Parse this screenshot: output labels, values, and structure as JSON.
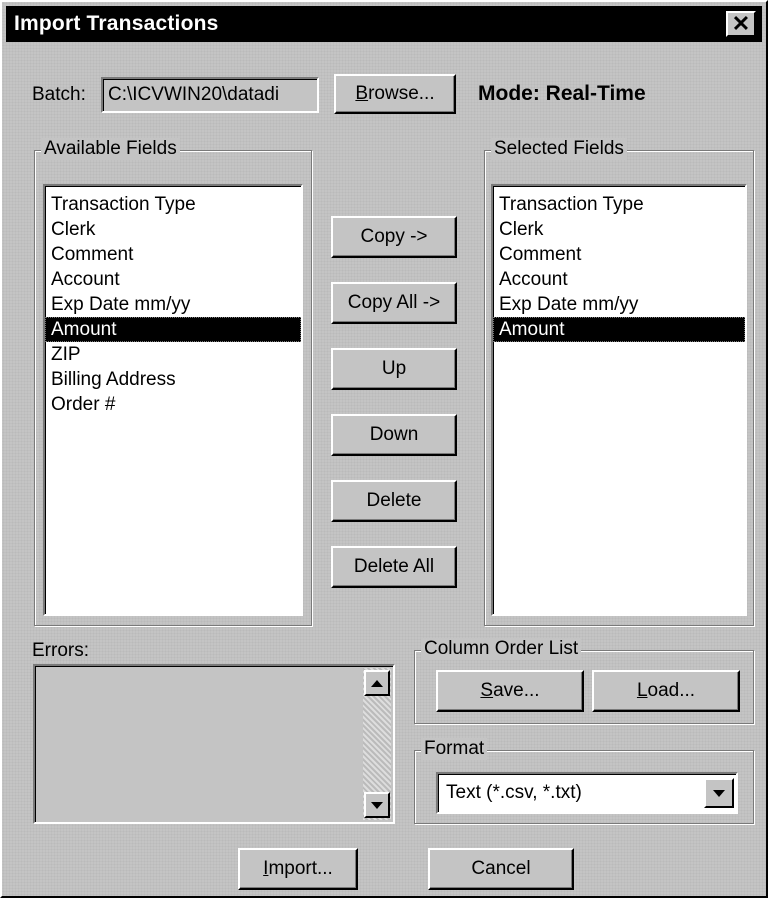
{
  "window": {
    "title": "Import Transactions",
    "close_glyph": "✕"
  },
  "batch": {
    "label": "Batch:",
    "value": "C:\\ICVWIN20\\datadi",
    "browse_label": "Browse...",
    "mode_text": "Mode: Real-Time"
  },
  "available_fields": {
    "title": "Available Fields",
    "items": [
      "Transaction Type",
      "Clerk",
      "Comment",
      "Account",
      "Exp Date mm/yy",
      "Amount",
      "ZIP",
      "Billing Address",
      "Order #"
    ],
    "selected_index": 5
  },
  "selected_fields": {
    "title": "Selected Fields",
    "items": [
      "Transaction Type",
      "Clerk",
      "Comment",
      "Account",
      "Exp Date mm/yy",
      "Amount"
    ],
    "selected_index": 5
  },
  "actions": {
    "copy": "Copy ->",
    "copy_all": "Copy All ->",
    "up": "Up",
    "down": "Down",
    "delete": "Delete",
    "delete_all": "Delete All"
  },
  "errors": {
    "label": "Errors:",
    "value": ""
  },
  "column_order": {
    "title": "Column Order List",
    "save": "Save...",
    "load": "Load...",
    "save_mnemonic": "S",
    "load_mnemonic": "L"
  },
  "format": {
    "title": "Format",
    "selected": "Text (*.csv, *.txt)"
  },
  "footer": {
    "import": "Import...",
    "cancel": "Cancel"
  },
  "colors": {
    "face": "#c4c4c4",
    "titlebar": "#000000",
    "selection": "#000000"
  }
}
